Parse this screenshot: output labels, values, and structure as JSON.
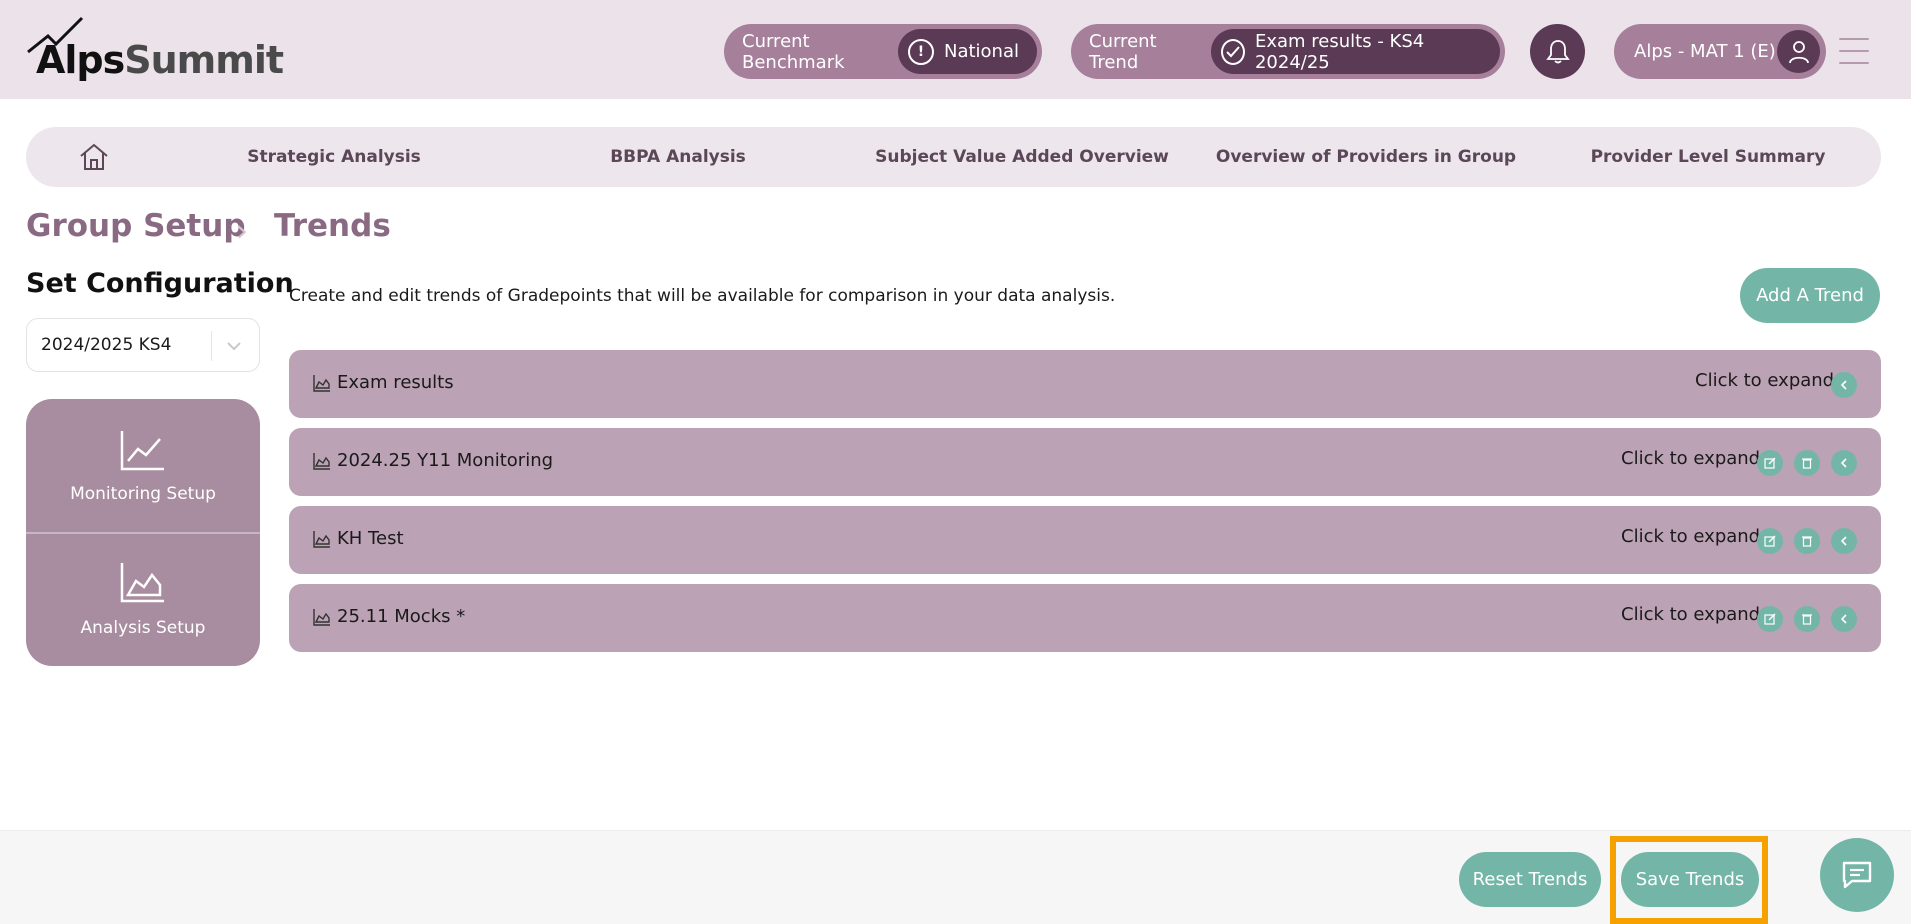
{
  "app": {
    "logo_primary": "Alps",
    "logo_secondary": "Summit"
  },
  "header": {
    "benchmark_label": "Current Benchmark",
    "benchmark_value": "National",
    "trend_label": "Current Trend",
    "trend_value": "Exam results - KS4 2024/25",
    "user_label": "Alps - MAT 1 (E)"
  },
  "nav": {
    "items": [
      "Strategic Analysis",
      "BBPA Analysis",
      "Subject Value Added Overview",
      "Overview of Providers in Group",
      "Provider Level Summary"
    ]
  },
  "breadcrumb": {
    "parent": "Group Setup",
    "current": "Trends"
  },
  "left": {
    "title": "Set Configuration",
    "select_value": "2024/2025 KS4",
    "monitoring_label": "Monitoring Setup",
    "analysis_label": "Analysis Setup"
  },
  "main": {
    "intro": "Create and edit trends of Gradepoints that will be available for comparison in your data analysis.",
    "add_label": "Add A Trend",
    "expand_label": "Click to expand",
    "trends": [
      {
        "name": "Exam results",
        "editable": false
      },
      {
        "name": "2024.25 Y11 Monitoring",
        "editable": true
      },
      {
        "name": "KH Test",
        "editable": true
      },
      {
        "name": "25.11 Mocks *",
        "editable": true
      }
    ]
  },
  "footer": {
    "reset_label": "Reset Trends",
    "save_label": "Save Trends"
  },
  "colors": {
    "accent_teal": "#73b6a8",
    "plum_dark": "#5a3a54",
    "plum_mid": "#a67f9b",
    "row_plum": "#bba2b4",
    "highlight": "#f5a100"
  }
}
